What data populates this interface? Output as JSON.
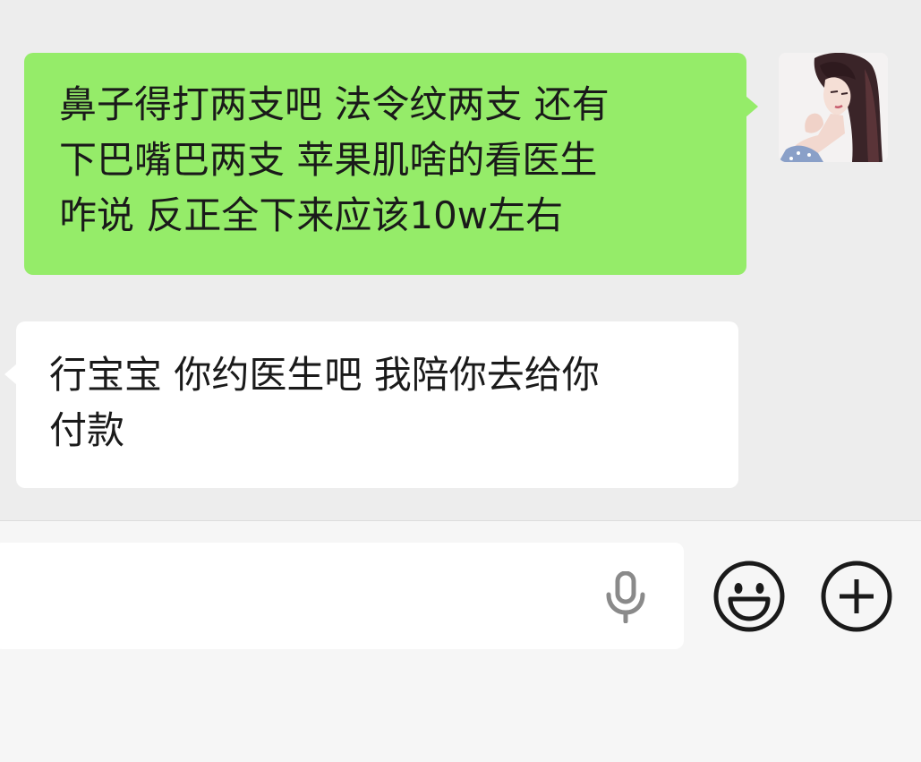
{
  "messages": [
    {
      "direction": "sent",
      "lines": [
        "鼻子得打两支吧 法令纹两支 还有",
        "下巴嘴巴两支 苹果肌啥的看医生",
        "咋说 反正全下来应该10w左右"
      ]
    },
    {
      "direction": "received",
      "lines": [
        "行宝宝 你约医生吧 我陪你去给你",
        "付款"
      ]
    }
  ],
  "input_bar": {
    "value": "",
    "icons": [
      "microphone-icon",
      "emoji-icon",
      "plus-icon"
    ]
  },
  "colors": {
    "sent_bubble": "#95ec69",
    "received_bubble": "#ffffff",
    "chat_background": "#ededed",
    "input_bar_background": "#f6f6f6"
  }
}
